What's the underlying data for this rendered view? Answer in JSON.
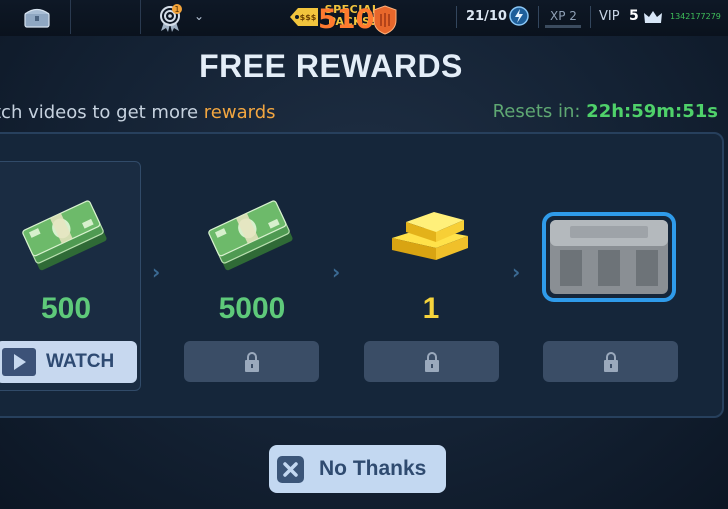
{
  "topbar": {
    "special_packs_line1": "SPECIAL",
    "special_packs_line2": "PACKS!",
    "packs_icon_text": "$$$",
    "achievement_badge": "1",
    "coins": "510",
    "energy": "21/10",
    "xp": "XP 2",
    "vip_label": "VIP",
    "vip_level": "5",
    "player_id": "1342177279"
  },
  "dialog": {
    "title": "FREE REWARDS",
    "subtitle_prefix": "tch videos to get more ",
    "subtitle_highlight": "rewards",
    "resets_label": "Resets in: ",
    "resets_time": "22h:59m:51s"
  },
  "rewards": [
    {
      "amount": "500",
      "type": "cash-icon",
      "state": "active"
    },
    {
      "amount": "5000",
      "type": "cash-icon",
      "state": "locked"
    },
    {
      "amount": "1",
      "type": "gold-icon",
      "state": "locked"
    },
    {
      "amount": "",
      "type": "crate-icon",
      "state": "locked"
    }
  ],
  "watch_button": {
    "label": "WATCH"
  },
  "no_thanks_button": {
    "label": "No Thanks"
  },
  "colors": {
    "accent_orange": "#ff7a2f",
    "green": "#5ec97a",
    "gold": "#f5d33c",
    "button_bg": "#c3d8f1"
  }
}
